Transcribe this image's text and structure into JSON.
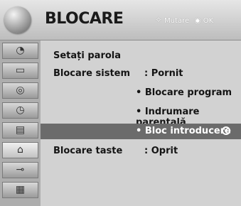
{
  "header": {
    "title": "BLOCARE",
    "hint_move_icon": "✧",
    "hint_move_label": "Mutare",
    "hint_ok_icon": "◉",
    "hint_ok_label": "OK"
  },
  "sidebar": {
    "items": [
      {
        "icon": "satellite-dish-icon",
        "glyph": "◔"
      },
      {
        "icon": "monitor-icon",
        "glyph": "▭"
      },
      {
        "icon": "speaker-icon",
        "glyph": "◎"
      },
      {
        "icon": "clock-icon",
        "glyph": "◷"
      },
      {
        "icon": "calendar-icon",
        "glyph": "▤"
      },
      {
        "icon": "lock-icon",
        "glyph": "⌂"
      },
      {
        "icon": "plug-icon",
        "glyph": "⊸"
      },
      {
        "icon": "clapperboard-icon",
        "glyph": "▦"
      }
    ],
    "active_index": 5
  },
  "menu": {
    "set_password": "Setați parola",
    "system_lock_label": "Blocare sistem",
    "system_lock_value": ": Pornit",
    "block_program": "• Blocare program",
    "parental_guidance": "• Indrumare parentală",
    "input_block": "• Bloc introducere",
    "key_lock_label": "Blocare taste",
    "key_lock_value": ": Oprit"
  }
}
